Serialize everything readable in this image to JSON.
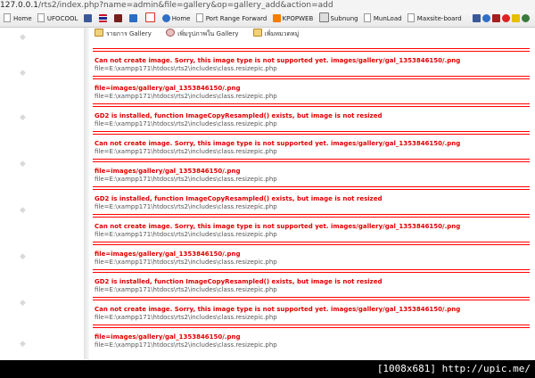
{
  "browser": {
    "url_host": "127.0.0.1",
    "url_path": "/rts2/index.php?name=admin&file=gallery&op=gallery_add&action=add",
    "bookmarks": [
      {
        "label": "Home",
        "icon": "page-icon"
      },
      {
        "label": "UFOCOOL",
        "icon": "page-icon"
      },
      {
        "label": "",
        "icon": "facebook-icon",
        "color": "#3b5998"
      },
      {
        "label": "",
        "icon": "thai-flag-icon",
        "color": "#1b2a8a"
      },
      {
        "label": "",
        "icon": "extension-icon",
        "color": "#7a1d1d"
      },
      {
        "label": "",
        "icon": "zing-icon",
        "color": "#2b6cc4"
      },
      {
        "label": "",
        "icon": "gmail-icon",
        "color": "#d93025"
      },
      {
        "label": "Home",
        "icon": "globe-icon",
        "color": "#2f6fc6"
      },
      {
        "label": "Port Range Forward",
        "icon": "page-icon"
      },
      {
        "label": "KPOPWEB",
        "icon": "blogger-icon",
        "color": "#f57d00"
      },
      {
        "label": "Subnung",
        "icon": "subnung-icon",
        "color": "#555555"
      },
      {
        "label": "MunLoad",
        "icon": "page-icon"
      },
      {
        "label": "Maxsite-board",
        "icon": "page-icon"
      }
    ]
  },
  "gallery_tabs": [
    {
      "label": "รายการ Gallery",
      "icon": "folder-icon"
    },
    {
      "label": "เพิ่มรูปภาพใน Gallery",
      "icon": "image-add-icon"
    },
    {
      "label": "เพิ่มหมวดหมู่",
      "icon": "folder-add-icon"
    }
  ],
  "errors": [
    {
      "message": "Can not create image. Sorry, this image type is not supported yet. images/gallery/gal_1353846150/.png",
      "file": "file=E:\\xampp171\\htdocs\\rts2\\includes\\class.resizepic.php"
    },
    {
      "message": "file=images/gallery/gal_1353846150/.png",
      "file": "file=E:\\xampp171\\htdocs\\rts2\\includes\\class.resizepic.php"
    },
    {
      "message": "GD2 is installed, function ImageCopyResampled() exists, but image is not resized",
      "file": "file=E:\\xampp171\\htdocs\\rts2\\includes\\class.resizepic.php"
    },
    {
      "message": "Can not create image. Sorry, this image type is not supported yet. images/gallery/gal_1353846150/.png",
      "file": "file=E:\\xampp171\\htdocs\\rts2\\includes\\class.resizepic.php"
    },
    {
      "message": "file=images/gallery/gal_1353846150/.png",
      "file": "file=E:\\xampp171\\htdocs\\rts2\\includes\\class.resizepic.php"
    },
    {
      "message": "GD2 is installed, function ImageCopyResampled() exists, but image is not resized",
      "file": "file=E:\\xampp171\\htdocs\\rts2\\includes\\class.resizepic.php"
    },
    {
      "message": "Can not create image. Sorry, this image type is not supported yet. images/gallery/gal_1353846150/.png",
      "file": "file=E:\\xampp171\\htdocs\\rts2\\includes\\class.resizepic.php"
    },
    {
      "message": "file=images/gallery/gal_1353846150/.png",
      "file": "file=E:\\xampp171\\htdocs\\rts2\\includes\\class.resizepic.php"
    },
    {
      "message": "GD2 is installed, function ImageCopyResampled() exists, but image is not resized",
      "file": "file=E:\\xampp171\\htdocs\\rts2\\includes\\class.resizepic.php"
    },
    {
      "message": "Can not create image. Sorry, this image type is not supported yet. images/gallery/gal_1353846150/.png",
      "file": "file=E:\\xampp171\\htdocs\\rts2\\includes\\class.resizepic.php"
    },
    {
      "message": "file=images/gallery/gal_1353846150/.png",
      "file": "file=E:\\xampp171\\htdocs\\rts2\\includes\\class.resizepic.php"
    }
  ],
  "watermark": "[1008x681] http://upic.me/",
  "colors": {
    "error": "#e00000",
    "rule": "#ff0000"
  }
}
